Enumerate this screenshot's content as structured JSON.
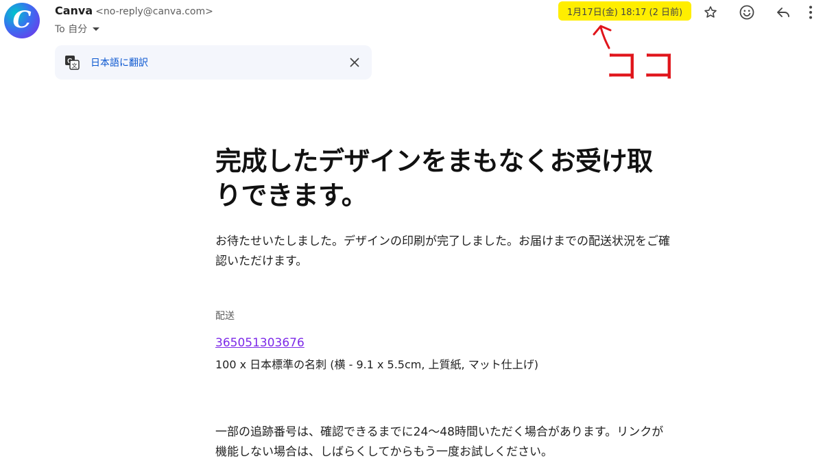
{
  "sender": {
    "avatar_letter": "C",
    "name": "Canva",
    "email": "<no-reply@canva.com>"
  },
  "recipient": {
    "label": "To 自分"
  },
  "timestamp": "1月17日(金) 18:17 (2 日前)",
  "highlight_color": "#ffee00",
  "annotation": {
    "text": "ココ",
    "color": "#e0151b"
  },
  "icons": {
    "star": "star-icon",
    "emoji": "emoji-icon",
    "reply": "reply-icon",
    "more": "more-vert-icon",
    "translate": "translate-icon",
    "close": "close-icon"
  },
  "translate_bar": {
    "link": "日本語に翻訳"
  },
  "email": {
    "headline": "完成したデザインをまもなくお受け取りできます。",
    "intro": "お待たせいたしました。デザインの印刷が完了しました。お届けまでの配送状況をご確認いただけます。",
    "shipping_label": "配送",
    "tracking_number": "365051303676",
    "product": "100 x 日本標準の名刺 (横 - 9.1 x 5.5cm, 上質紙, マット仕上げ)",
    "notice": "一部の追跡番号は、確認できるまでに24〜48時間いただく場合があります。リンクが機能しない場合は、しばらくしてからもう一度お試しください。"
  },
  "brand_color": "#7d2ae8",
  "link_color": "#0b57d0"
}
